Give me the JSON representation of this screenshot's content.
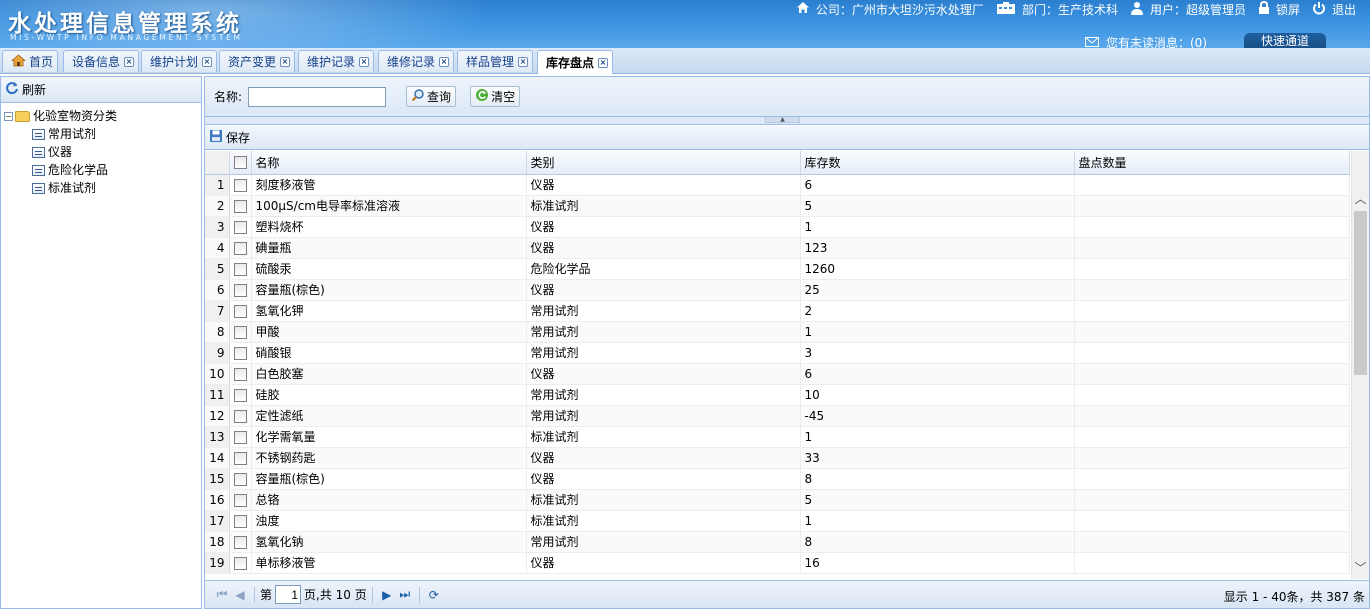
{
  "header": {
    "title": "水处理信息管理系统",
    "subtitle": "MIS-WWTP INFO MANAGEMENT SYSTEM",
    "company": "公司：广州市大坦沙污水处理厂",
    "department": "部门：生产技术科",
    "user": "用户：超级管理员",
    "lock": "锁屏",
    "logout": "退出",
    "unread": "您有未读消息：(0)",
    "quick": "快速通道"
  },
  "tabs": [
    {
      "label": "首页"
    },
    {
      "label": "设备信息"
    },
    {
      "label": "维护计划"
    },
    {
      "label": "资产变更"
    },
    {
      "label": "维护记录"
    },
    {
      "label": "维修记录"
    },
    {
      "label": "样品管理"
    },
    {
      "label": "库存盘点"
    }
  ],
  "west": {
    "refresh": "刷新",
    "root": "化验室物资分类",
    "children": [
      "常用试剂",
      "仪器",
      "危险化学品",
      "标准试剂"
    ]
  },
  "search": {
    "name_label": "名称:",
    "name_value": "",
    "query": "查询",
    "clear": "清空"
  },
  "toolbar": {
    "save": "保存"
  },
  "grid": {
    "columns": [
      "名称",
      "类别",
      "库存数",
      "盘点数量"
    ],
    "rows": [
      [
        "1",
        "刻度移液管",
        "仪器",
        "6",
        ""
      ],
      [
        "2",
        "100μS/cm电导率标准溶液",
        "标准试剂",
        "5",
        ""
      ],
      [
        "3",
        "塑料烧杯",
        "仪器",
        "1",
        ""
      ],
      [
        "4",
        "碘量瓶",
        "仪器",
        "123",
        ""
      ],
      [
        "5",
        "硫酸汞",
        "危险化学品",
        "1260",
        ""
      ],
      [
        "6",
        "容量瓶(棕色)",
        "仪器",
        "25",
        ""
      ],
      [
        "7",
        "氢氧化钾",
        "常用试剂",
        "2",
        ""
      ],
      [
        "8",
        "甲酸",
        "常用试剂",
        "1",
        ""
      ],
      [
        "9",
        "硝酸银",
        "常用试剂",
        "3",
        ""
      ],
      [
        "10",
        "白色胶塞",
        "仪器",
        "6",
        ""
      ],
      [
        "11",
        "硅胶",
        "常用试剂",
        "10",
        ""
      ],
      [
        "12",
        "定性滤纸",
        "常用试剂",
        "-45",
        ""
      ],
      [
        "13",
        "化学需氧量",
        "标准试剂",
        "1",
        ""
      ],
      [
        "14",
        "不锈钢药匙",
        "仪器",
        "33",
        ""
      ],
      [
        "15",
        "容量瓶(棕色)",
        "仪器",
        "8",
        ""
      ],
      [
        "16",
        "总铬",
        "标准试剂",
        "5",
        ""
      ],
      [
        "17",
        "浊度",
        "标准试剂",
        "1",
        ""
      ],
      [
        "18",
        "氢氧化钠",
        "常用试剂",
        "8",
        ""
      ],
      [
        "19",
        "单标移液管",
        "仪器",
        "16",
        ""
      ]
    ]
  },
  "pager": {
    "page_prefix": "第",
    "page_value": "1",
    "page_suffix": "页,共 10 页",
    "display": "显示 1 - 40条，共 387 条"
  }
}
